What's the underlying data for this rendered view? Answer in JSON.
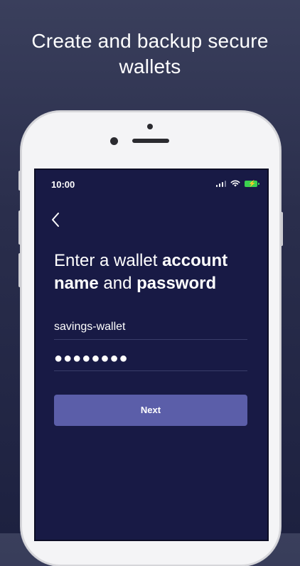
{
  "headline": {
    "line1": "Create and backup secure",
    "line2": "wallets"
  },
  "status_bar": {
    "time": "10:00",
    "icons": [
      "signal-icon",
      "wifi-icon",
      "battery-charging-icon"
    ]
  },
  "screen": {
    "back_icon": "chevron-left-icon",
    "title": {
      "part1": "Enter a wallet ",
      "bold1": "account",
      "bold2": "name",
      "part2": " and ",
      "bold3": "password"
    },
    "account_field": {
      "value": "savings-wallet"
    },
    "password_field": {
      "value": "●●●●●●●●"
    },
    "next_label": "Next"
  },
  "colors": {
    "background_top": "#3a3f5c",
    "screen_bg": "#181a45",
    "button_bg": "#5b5ea9",
    "battery": "#3bd14f"
  }
}
